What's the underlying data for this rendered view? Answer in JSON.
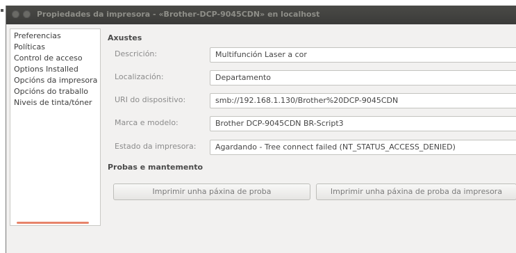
{
  "window": {
    "title": "Propiedades da impresora - «Brother-DCP-9045CDN» en localhost"
  },
  "sidebar": {
    "items": [
      {
        "label": "Preferencias"
      },
      {
        "label": "Políticas"
      },
      {
        "label": "Control de acceso"
      },
      {
        "label": "Options Installed"
      },
      {
        "label": "Opcións da impresora"
      },
      {
        "label": "Opcións do traballo"
      },
      {
        "label": "Niveis de tinta/tóner"
      }
    ]
  },
  "settings": {
    "heading": "Axustes",
    "rows": [
      {
        "label": "Descrición:",
        "value": "Multifunción Laser a cor"
      },
      {
        "label": "Localización:",
        "value": "Departamento"
      },
      {
        "label": "URI do dispositivo:",
        "value": "smb://192.168.1.130/Brother%20DCP-9045CDN"
      },
      {
        "label": "Marca e modelo:",
        "value": "Brother DCP-9045CDN BR-Script3"
      },
      {
        "label": "Estado da impresora:",
        "value": "Agardando - Tree connect failed (NT_STATUS_ACCESS_DENIED)"
      }
    ]
  },
  "maintenance": {
    "heading": "Probas e mantemento",
    "print_test_label": "Imprimir unha páxina de proba",
    "print_printer_test_label": "Imprimir unha páxina de proba da impresora"
  }
}
